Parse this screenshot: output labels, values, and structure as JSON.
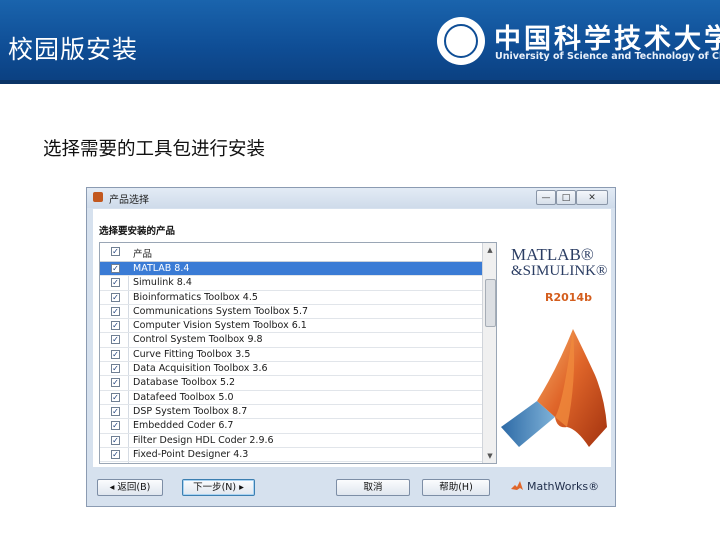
{
  "slide": {
    "title": "校园版安装",
    "university_cn": "中国科学技术大学",
    "university_en": "University of Science and Technology of China",
    "subtitle": "选择需要的工具包进行安装"
  },
  "window": {
    "title": "产品选择",
    "buttons": {
      "minimize": "—",
      "maximize": "□",
      "close": "✕"
    }
  },
  "installer": {
    "prompt": "选择要安装的产品",
    "column_header": "产品",
    "products": [
      {
        "label": "MATLAB 8.4",
        "checked": true,
        "selected": true
      },
      {
        "label": "Simulink 8.4",
        "checked": true,
        "selected": false
      },
      {
        "label": "Bioinformatics Toolbox 4.5",
        "checked": true,
        "selected": false
      },
      {
        "label": "Communications System Toolbox 5.7",
        "checked": true,
        "selected": false
      },
      {
        "label": "Computer Vision System Toolbox 6.1",
        "checked": true,
        "selected": false
      },
      {
        "label": "Control System Toolbox 9.8",
        "checked": true,
        "selected": false
      },
      {
        "label": "Curve Fitting Toolbox 3.5",
        "checked": true,
        "selected": false
      },
      {
        "label": "Data Acquisition Toolbox 3.6",
        "checked": true,
        "selected": false
      },
      {
        "label": "Database Toolbox 5.2",
        "checked": true,
        "selected": false
      },
      {
        "label": "Datafeed Toolbox 5.0",
        "checked": true,
        "selected": false
      },
      {
        "label": "DSP System Toolbox 8.7",
        "checked": true,
        "selected": false
      },
      {
        "label": "Embedded Coder 6.7",
        "checked": true,
        "selected": false
      },
      {
        "label": "Filter Design HDL Coder 2.9.6",
        "checked": true,
        "selected": false
      },
      {
        "label": "Fixed-Point Designer 4.3",
        "checked": true,
        "selected": false
      }
    ],
    "branding": {
      "product_line1": "MATLAB®",
      "product_line2": "&SIMULINK®",
      "release": "R2014b",
      "vendor": "MathWorks®"
    },
    "buttons": {
      "back": "◂ 返回(B)",
      "next": "下一步(N) ▸",
      "cancel": "取消",
      "help": "帮助(H)"
    }
  },
  "colors": {
    "banner": "#1259a3",
    "selection": "#3a7bd5",
    "release": "#d45e1e",
    "membrane": "#e0662a"
  }
}
